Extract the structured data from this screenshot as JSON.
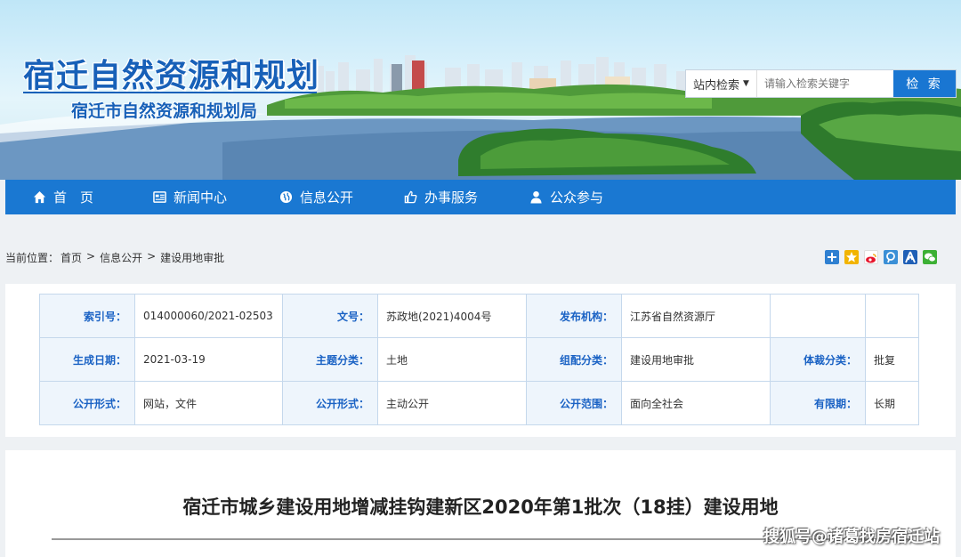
{
  "site": {
    "title": "宿迁自然资源和规划",
    "subtitle": "宿迁市自然资源和规划局"
  },
  "search": {
    "scope": "站内检索",
    "scope_arrow": "▼",
    "placeholder": "请输入检索关键字",
    "button": "检 索"
  },
  "nav": {
    "items": [
      {
        "label": "首　页",
        "icon": "home-icon"
      },
      {
        "label": "新闻中心",
        "icon": "news-icon"
      },
      {
        "label": "信息公开",
        "icon": "globe-icon"
      },
      {
        "label": "办事服务",
        "icon": "thumbs-up-icon"
      },
      {
        "label": "公众参与",
        "icon": "user-icon"
      }
    ]
  },
  "breadcrumb": {
    "prefix": "当前位置：",
    "items": [
      "首页",
      "信息公开",
      "建设用地审批"
    ],
    "separator": ">"
  },
  "share_icons": [
    {
      "name": "share-plus-icon",
      "color": "#2f80d1"
    },
    {
      "name": "share-qzone-icon",
      "color": "#f2b400"
    },
    {
      "name": "share-weibo-icon",
      "color": "#e6162d"
    },
    {
      "name": "share-tqq-icon",
      "color": "#3a8fd6"
    },
    {
      "name": "share-renren-icon",
      "color": "#1f5fb6"
    },
    {
      "name": "share-wechat-icon",
      "color": "#3cb034"
    }
  ],
  "meta": {
    "rows": [
      [
        {
          "k": "索引号：",
          "v": "014000060/2021-02503"
        },
        {
          "k": "文号：",
          "v": "苏政地(2021)4004号"
        },
        {
          "k": "发布机构：",
          "v": "江苏省自然资源厅"
        },
        {
          "k": "",
          "v": ""
        }
      ],
      [
        {
          "k": "生成日期：",
          "v": "2021-03-19"
        },
        {
          "k": "主题分类：",
          "v": "土地"
        },
        {
          "k": "组配分类：",
          "v": "建设用地审批"
        },
        {
          "k": "体裁分类：",
          "v": "批复"
        }
      ],
      [
        {
          "k": "公开形式：",
          "v": "网站，文件"
        },
        {
          "k": "公开形式：",
          "v": "主动公开"
        },
        {
          "k": "公开范围：",
          "v": "面向全社会"
        },
        {
          "k": "有限期：",
          "v": "长期"
        }
      ]
    ]
  },
  "article": {
    "title": "宿迁市城乡建设用地增减挂钩建新区2020年第1批次（18挂）建设用地"
  },
  "watermark": "搜狐号@诸葛找房宿迁站"
}
